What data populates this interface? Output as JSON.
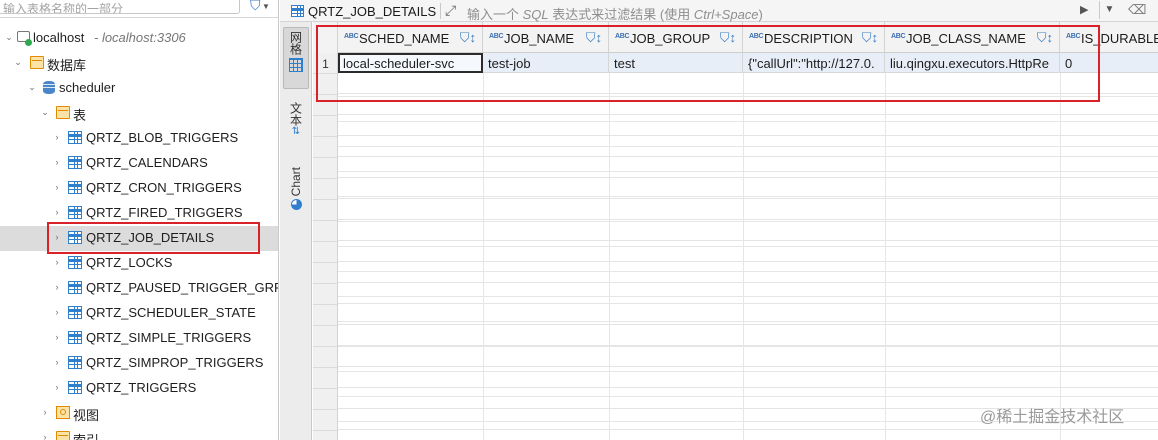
{
  "navigator": {
    "filter_placeholder": "输入表格名称的一部分",
    "tree": {
      "connection": {
        "label": "localhost",
        "host": "- localhost:3306"
      },
      "databases_folder": "数据库",
      "schema": "scheduler",
      "tables_folder": "表",
      "tables": [
        "QRTZ_BLOB_TRIGGERS",
        "QRTZ_CALENDARS",
        "QRTZ_CRON_TRIGGERS",
        "QRTZ_FIRED_TRIGGERS",
        "QRTZ_JOB_DETAILS",
        "QRTZ_LOCKS",
        "QRTZ_PAUSED_TRIGGER_GRPS",
        "QRTZ_SCHEDULER_STATE",
        "QRTZ_SIMPLE_TRIGGERS",
        "QRTZ_SIMPROP_TRIGGERS",
        "QRTZ_TRIGGERS"
      ],
      "selected_table": "QRTZ_JOB_DETAILS",
      "views_folder": "视图",
      "indexes_folder": "索引"
    }
  },
  "editor": {
    "table_name": "QRTZ_JOB_DETAILS",
    "filter_placeholder_prefix": "输入一个",
    "filter_placeholder_sql": "SQL",
    "filter_placeholder_suffix": "表达式来过滤结果 (使用",
    "filter_placeholder_shortcut": "Ctrl+Space",
    "filter_placeholder_close": ")"
  },
  "side_tabs": [
    {
      "label": "网格",
      "active": true
    },
    {
      "label": "文本",
      "active": false
    },
    {
      "label": "Chart",
      "active": false
    }
  ],
  "grid": {
    "columns": [
      {
        "type_icon": "ABC",
        "name": "SCHED_NAME"
      },
      {
        "type_icon": "ABC",
        "name": "JOB_NAME"
      },
      {
        "type_icon": "ABC",
        "name": "JOB_GROUP"
      },
      {
        "type_icon": "ABC",
        "name": "DESCRIPTION"
      },
      {
        "type_icon": "ABC",
        "name": "JOB_CLASS_NAME"
      },
      {
        "type_icon": "ABC",
        "name": "IS_DURABLE"
      }
    ],
    "rows": [
      {
        "row_number": "1",
        "cells": [
          "local-scheduler-svc",
          "test-job",
          "test",
          "{\"callUrl\":\"http://127.0.",
          "liu.qingxu.executors.HttpRe",
          "0"
        ]
      }
    ]
  },
  "watermark": "@稀土掘金技术社区",
  "colors": {
    "highlight_box": "#d9212a",
    "selection_row": "#e8eef7",
    "accent": "#3b7fc4"
  }
}
